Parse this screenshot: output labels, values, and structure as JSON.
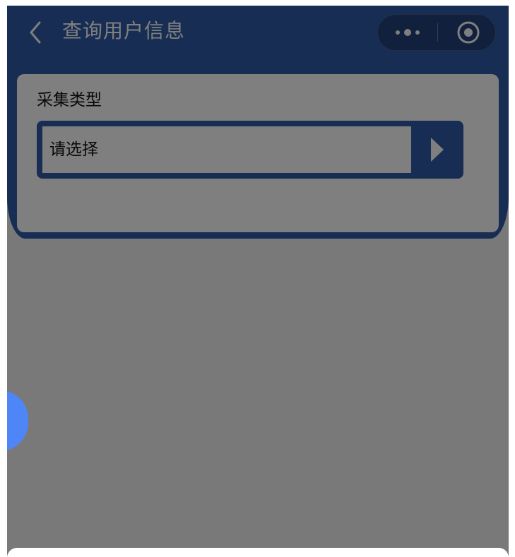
{
  "navbar": {
    "title": "查询用户信息",
    "back_icon": "chevron-left-icon",
    "more_icon": "more-dots-icon",
    "close_icon": "target-close-icon"
  },
  "form": {
    "collect_type": {
      "label": "采集类型",
      "placeholder": "请选择",
      "arrow_icon": "caret-right-icon"
    }
  },
  "colors": {
    "brand_blue": "#2f5aa6",
    "overlay": "rgba(0,0,0,0.5)",
    "float_ball": "#4f86f7"
  },
  "overlay": {
    "visible": true
  }
}
